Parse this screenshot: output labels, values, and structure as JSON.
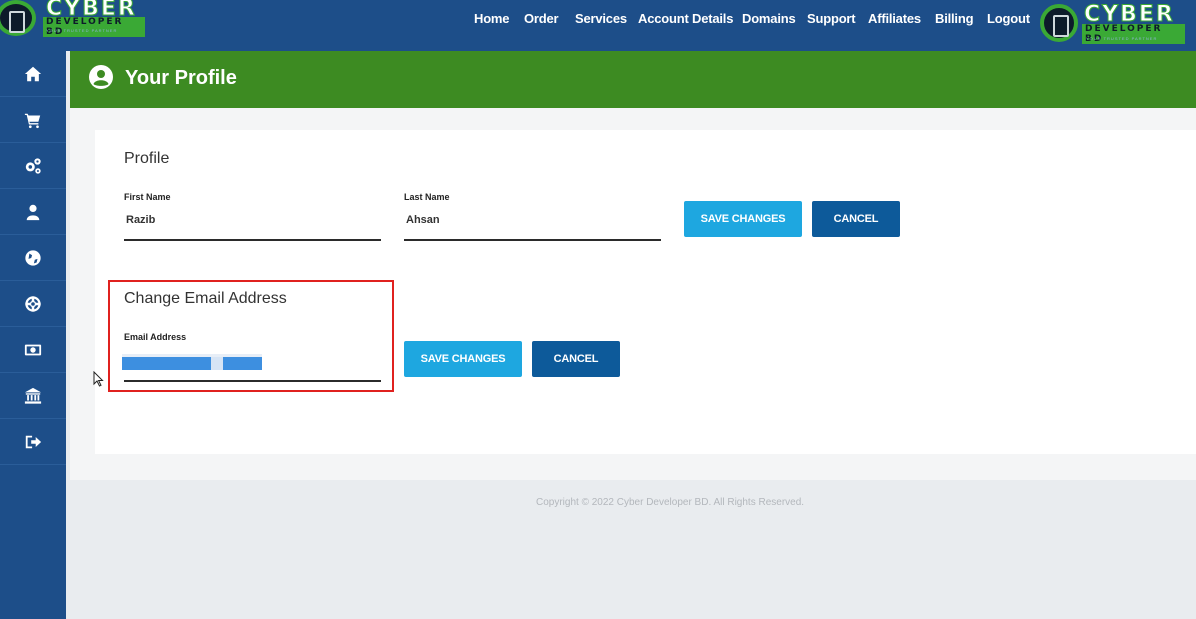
{
  "brand": {
    "word": "CYBER",
    "subword": "DEVELOPER BD",
    "tagline": "YOUR TRUSTED PARTNER"
  },
  "nav": {
    "items": [
      "Home",
      "Order",
      "Services",
      "Account Details",
      "Domains",
      "Support",
      "Affiliates",
      "Billing",
      "Logout"
    ]
  },
  "sidebar": {
    "icons": [
      "home-icon",
      "cart-icon",
      "gears-icon",
      "user-icon",
      "globe-icon",
      "lifebuoy-icon",
      "money-icon",
      "bank-icon",
      "sign-out-icon"
    ]
  },
  "header": {
    "title": "Your Profile",
    "icon": "user-circle-icon"
  },
  "profile": {
    "title": "Profile",
    "first_name_label": "First Name",
    "first_name_value": "Razib",
    "last_name_label": "Last Name",
    "last_name_value": "Ahsan",
    "save_label": "SAVE CHANGES",
    "cancel_label": "CANCEL"
  },
  "email": {
    "title": "Change Email Address",
    "label": "Email Address",
    "save_label": "SAVE CHANGES",
    "cancel_label": "CANCEL"
  },
  "footer": {
    "copyright": "Copyright © 2022 Cyber Developer BD. All Rights Reserved."
  },
  "colors": {
    "nav_bg": "#1d4e89",
    "banner_green": "#3d8b22",
    "save_button": "#1ea7e0",
    "cancel_button": "#0d5a9a",
    "highlight_red": "#e0211f"
  }
}
